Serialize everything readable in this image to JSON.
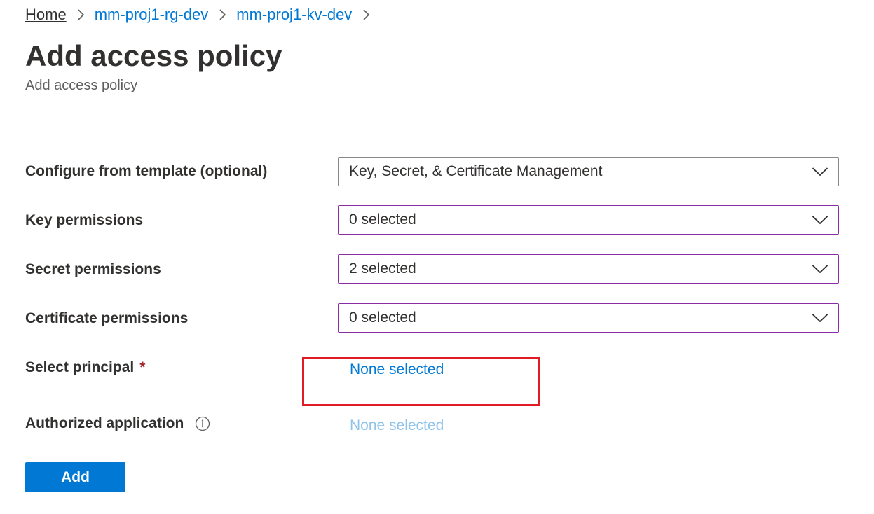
{
  "breadcrumb": {
    "items": [
      "Home",
      "mm-proj1-rg-dev",
      "mm-proj1-kv-dev"
    ]
  },
  "page": {
    "title": "Add access policy",
    "subtitle": "Add access policy"
  },
  "form": {
    "template": {
      "label": "Configure from template (optional)",
      "value": "Key, Secret, & Certificate Management"
    },
    "key_permissions": {
      "label": "Key permissions",
      "value": "0 selected"
    },
    "secret_permissions": {
      "label": "Secret permissions",
      "value": "2 selected"
    },
    "certificate_permissions": {
      "label": "Certificate permissions",
      "value": "0 selected"
    },
    "principal": {
      "label": "Select principal",
      "required_marker": "*",
      "value": "None selected"
    },
    "authorized_application": {
      "label": "Authorized application",
      "value": "None selected"
    }
  },
  "actions": {
    "add_label": "Add"
  },
  "icons": {
    "breadcrumb_separator": "chevron-right-icon",
    "dropdown": "chevron-down-icon",
    "info": "info-icon"
  },
  "colors": {
    "link": "#0078d4",
    "link_disabled": "#8dc4ec",
    "primary_button": "#0078d4",
    "focused_border": "#8a2da5",
    "highlight": "#e21c26",
    "required": "#a4262c"
  }
}
